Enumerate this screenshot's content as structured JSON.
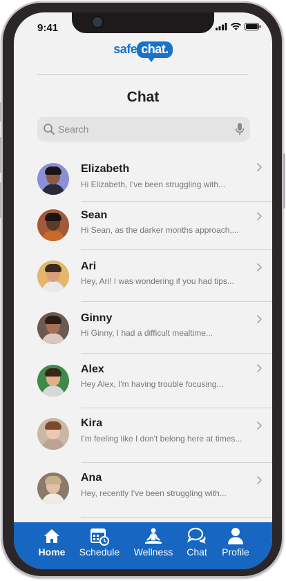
{
  "status_bar": {
    "time": "9:41"
  },
  "logo": {
    "part1": "safe",
    "part2": "chat."
  },
  "page": {
    "title": "Chat"
  },
  "search": {
    "placeholder": "Search"
  },
  "chats": [
    {
      "name": "Elizabeth",
      "preview": "Hi Elizabeth, I've been struggling with...",
      "avatar_bg": "#8b8fd6",
      "skin": "#8a5a44",
      "shirt": "#2a2a3a",
      "hair": "#1c1414"
    },
    {
      "name": "Sean",
      "preview": "Hi Sean, as the darker months approach,...",
      "avatar_bg": "#a35a3a",
      "skin": "#5b3a28",
      "shirt": "#c96a2a",
      "hair": "#1a1410"
    },
    {
      "name": "Ari",
      "preview": "Hey, Ari! I was wondering if you had tips...",
      "avatar_bg": "#e4b66a",
      "skin": "#d8a07a",
      "shirt": "#eaeaea",
      "hair": "#3a2a1e"
    },
    {
      "name": "Ginny",
      "preview": "Hi Ginny, I had a difficult mealtime...",
      "avatar_bg": "#6b5a52",
      "skin": "#a87055",
      "shirt": "#d9c7c0",
      "hair": "#2a1c16"
    },
    {
      "name": "Alex",
      "preview": "Hey Alex, I'm having trouble focusing...",
      "avatar_bg": "#3f8a4a",
      "skin": "#e0b08e",
      "shirt": "#d8d8d8",
      "hair": "#3a2616"
    },
    {
      "name": "Kira",
      "preview": "I'm feeling like I don't belong here at times...",
      "avatar_bg": "#c9b8a8",
      "skin": "#ecc9b0",
      "shirt": "#b9a493",
      "hair": "#7a4a2a"
    },
    {
      "name": "Ana",
      "preview": "Hey, recently I've been struggling with...",
      "avatar_bg": "#8a7a6a",
      "skin": "#e3bfa5",
      "shirt": "#f0ece6",
      "hair": "#c8b08a"
    }
  ],
  "tabs": [
    {
      "label": "Home",
      "icon": "home-icon",
      "active": true
    },
    {
      "label": "Schedule",
      "icon": "calendar-clock-icon",
      "active": false
    },
    {
      "label": "Wellness",
      "icon": "meditation-icon",
      "active": false
    },
    {
      "label": "Chat",
      "icon": "chat-bubbles-icon",
      "active": false
    },
    {
      "label": "Profile",
      "icon": "person-icon",
      "active": false
    }
  ],
  "colors": {
    "brand": "#1a73c8",
    "tabbar": "#1766c2",
    "background": "#f2f2f2"
  }
}
